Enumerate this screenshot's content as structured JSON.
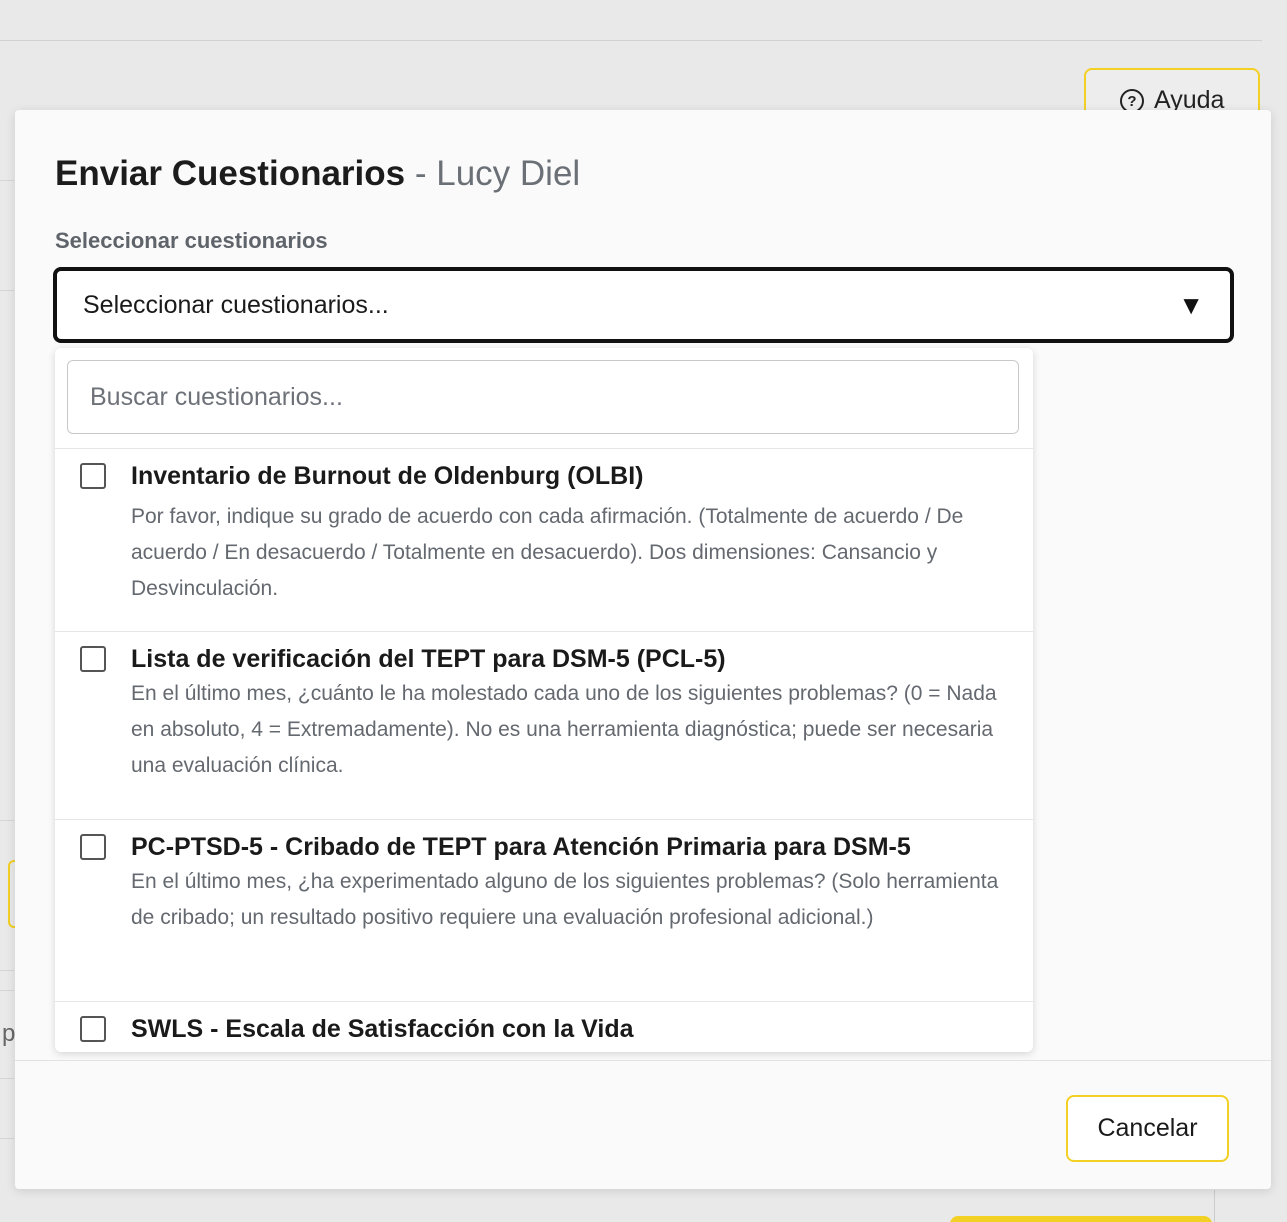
{
  "background": {
    "help_button_label": "Ayuda",
    "partial_char": "p"
  },
  "modal": {
    "title": "Enviar Cuestionarios",
    "title_separator": "-",
    "patient_name": "Lucy Diel",
    "field_label": "Seleccionar cuestionarios",
    "select": {
      "value": "Seleccionar cuestionarios...",
      "arrow_icon": "triangle-down-icon"
    },
    "dropdown": {
      "search_placeholder": "Buscar cuestionarios...",
      "options": [
        {
          "title": "Inventario de Burnout de Oldenburg (OLBI)",
          "description": "Por favor, indique su grado de acuerdo con cada afirmación. (Totalmente de acuerdo / De acuerdo / En desacuerdo / Totalmente en desacuerdo).  Dos dimensiones: Cansancio y Desvinculación.",
          "checked": false
        },
        {
          "title": "Lista de verificación del TEPT para DSM-5 (PCL-5)",
          "description": "En el último mes, ¿cuánto le ha molestado cada uno de los siguientes problemas? (0 = Nada en absoluto, 4 = Extremadamente). No es una herramienta diagnóstica; puede ser necesaria una evaluación clínica.",
          "checked": false
        },
        {
          "title": "PC-PTSD-5 - Cribado de TEPT para Atención Primaria para DSM-5",
          "description": "En el último mes, ¿ha experimentado alguno de los siguientes problemas? (Solo herramienta de cribado; un resultado positivo requiere una evaluación profesional adicional.)",
          "checked": false
        },
        {
          "title": "SWLS - Escala de Satisfacción con la Vida",
          "description": "",
          "checked": false
        }
      ]
    },
    "cancel_label": "Cancelar"
  },
  "colors": {
    "accent_yellow": "#f2d024",
    "overlay_bg": "#e9e9e9",
    "text_muted": "#646970"
  }
}
